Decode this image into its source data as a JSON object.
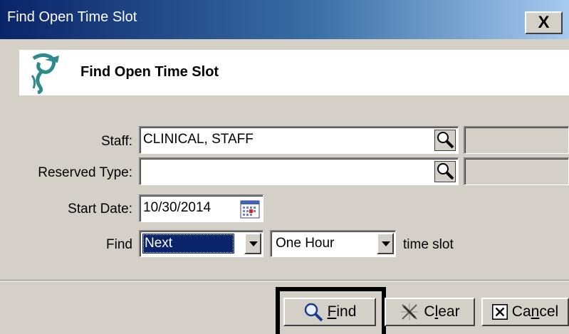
{
  "window": {
    "title": "Find Open Time Slot",
    "close_label": "X"
  },
  "header": {
    "title": "Find Open Time Slot"
  },
  "form": {
    "staff": {
      "label": "Staff:",
      "value": "CLINICAL, STAFF"
    },
    "reserved_type": {
      "label": "Reserved Type:",
      "value": ""
    },
    "start_date": {
      "label": "Start Date:",
      "value": "10/30/2014"
    },
    "find": {
      "label": "Find",
      "direction_selected": "Next",
      "duration_selected": "One Hour",
      "suffix": "time slot"
    }
  },
  "buttons": {
    "find": {
      "prefix": "",
      "mnemonic": "F",
      "rest": "ind"
    },
    "clear": {
      "prefix": "C",
      "mnemonic": "l",
      "rest": "ear"
    },
    "cancel": {
      "prefix": "Ca",
      "mnemonic": "n",
      "rest": "cel"
    }
  },
  "icons": {
    "logo": "logo-icon",
    "lookup": "magnifier-icon",
    "calendar": "calendar-icon",
    "clear": "eraser-icon",
    "cancel": "x-box-icon"
  },
  "colors": {
    "titlebar_start": "#0a246a",
    "titlebar_end": "#a6caf0",
    "face": "#d4d0c8",
    "selection": "#0a246a",
    "logo": "#2e8b8b"
  }
}
